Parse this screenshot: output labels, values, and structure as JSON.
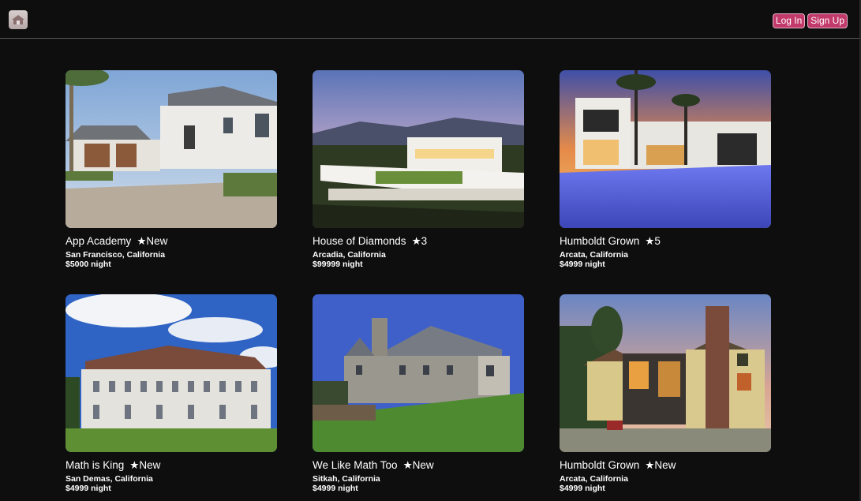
{
  "header": {
    "logo_icon": "house-logo-icon",
    "login_label": "Log In",
    "signup_label": "Sign Up"
  },
  "listings": [
    {
      "name": "App Academy",
      "rating": "★New",
      "location": "San Francisco, California",
      "price": "$5000 night",
      "photo": "white modern house with driveway and palm trees"
    },
    {
      "name": "House of Diamonds",
      "rating": "★3",
      "location": "Arcadia, California",
      "price": "$99999 night",
      "photo": "modern mansion on hillside at dusk"
    },
    {
      "name": "Humboldt Grown",
      "rating": "★5",
      "location": "Arcata, California",
      "price": "$4999 night",
      "photo": "modern villa with lit pool at sunset"
    },
    {
      "name": "Math is King",
      "rating": "★New",
      "location": "San Demas, California",
      "price": "$4999 night",
      "photo": "grand stone mansion under blue sky"
    },
    {
      "name": "We Like Math Too",
      "rating": "★New",
      "location": "Sitkah, California",
      "price": "$4999 night",
      "photo": "stone chateau on green hill"
    },
    {
      "name": "Humboldt Grown",
      "rating": "★New",
      "location": "Arcata, California",
      "price": "$4999 night",
      "photo": "yellow house with chimney and patio at dusk"
    }
  ],
  "colors": {
    "background": "#0e0e0f",
    "button": "#c23a6a",
    "divider": "#5a5a5a"
  }
}
